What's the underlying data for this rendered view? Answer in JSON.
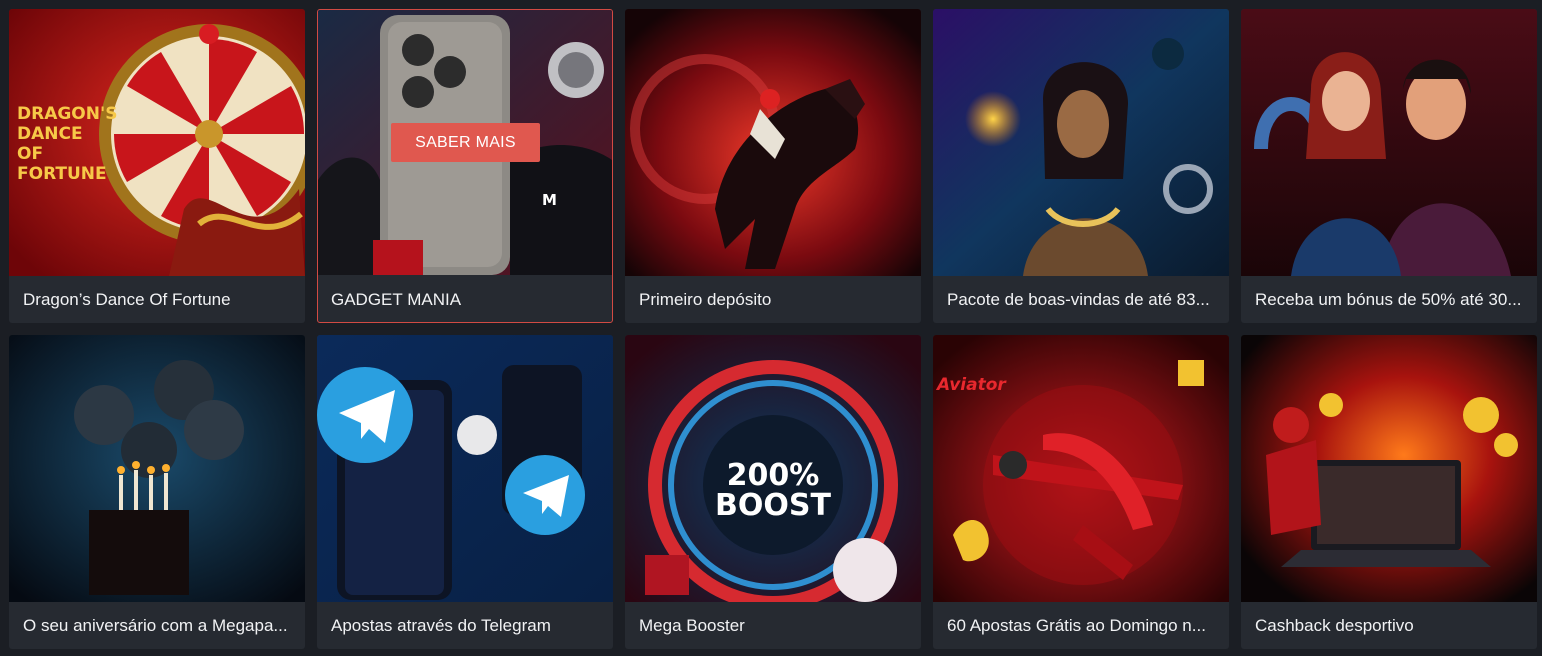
{
  "promotions": [
    {
      "title": "Dragon’s Dance Of Fortune",
      "art_text": "DRAGON'S DANCE OF FORTUNE",
      "theme_color": "#c8151b"
    },
    {
      "title": "GADGET MANIA",
      "cta_label": "SABER MAIS",
      "theme_color": "#8e1a2a"
    },
    {
      "title": "Primeiro depósito",
      "theme_color": "#b0101d"
    },
    {
      "title": "Pacote de boas-vindas de até 83...",
      "theme_color": "#4a1c8a"
    },
    {
      "title": "Receba um bónus de 50% até 30...",
      "theme_color": "#6b1322"
    },
    {
      "title": "O seu aniversário com a Megapa...",
      "theme_color": "#0f2a44"
    },
    {
      "title": "Apostas através do Telegram",
      "theme_color": "#1f6fd6"
    },
    {
      "title": "Mega Booster",
      "art_text": "200% BOOST",
      "theme_color": "#1c79ae"
    },
    {
      "title": "60 Apostas Grátis ao Domingo n...",
      "art_text": "Aviator",
      "theme_color": "#c01317"
    },
    {
      "title": "Cashback desportivo",
      "theme_color": "#e8461a"
    }
  ]
}
